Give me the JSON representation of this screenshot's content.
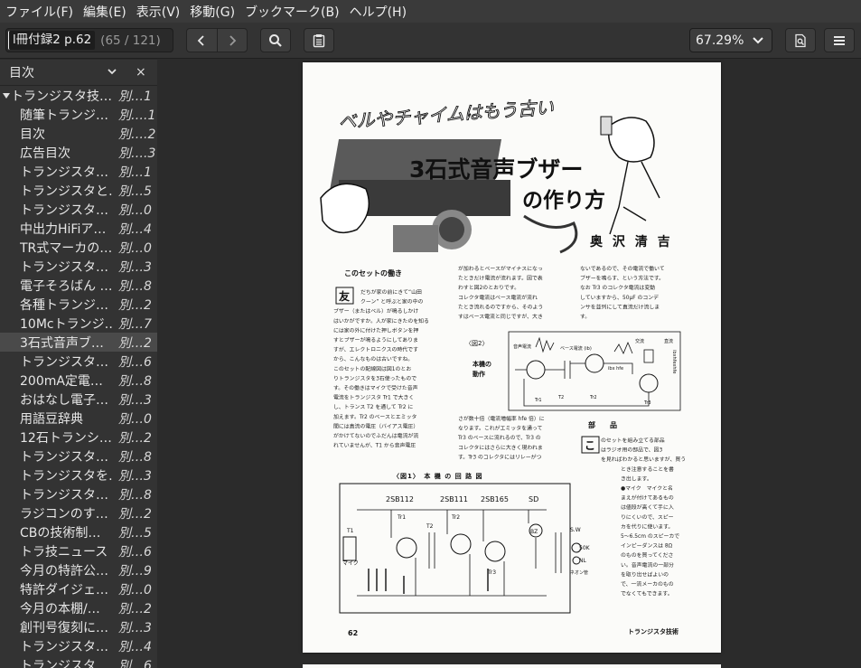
{
  "menu": [
    "ファイル(F)",
    "編集(E)",
    "表示(V)",
    "移動(G)",
    "ブックマーク(B)",
    "ヘルプ(H)"
  ],
  "toolbar": {
    "page_entry_value": "l冊付録2 p.62",
    "page_count": "(65 / 121)",
    "zoom": "67.29%",
    "icons": [
      "chevron-left-icon",
      "chevron-right-icon",
      "search-icon",
      "clipboard-icon",
      "document-search-icon",
      "hamburger-menu-icon"
    ]
  },
  "sidebar": {
    "title": "目次",
    "close_label": "×",
    "items": [
      {
        "label": "トランジスタ技…",
        "page": "別…1",
        "level": 0,
        "expanded": true
      },
      {
        "label": "随筆トランジ…",
        "page": "別….1",
        "level": 1
      },
      {
        "label": "目次",
        "page": "別….2",
        "level": 1
      },
      {
        "label": "広告目次",
        "page": "別….3",
        "level": 1
      },
      {
        "label": "トランジスタ…",
        "page": "別…1",
        "level": 1
      },
      {
        "label": "トランジスタと…",
        "page": "別…5",
        "level": 1
      },
      {
        "label": "トランジスタ…",
        "page": "別…0",
        "level": 1
      },
      {
        "label": "中出力HiFiア…",
        "page": "別…4",
        "level": 1
      },
      {
        "label": "TR式マーカの…",
        "page": "別…0",
        "level": 1
      },
      {
        "label": "トランジスタ…",
        "page": "別…3",
        "level": 1
      },
      {
        "label": "電子そろばん …",
        "page": "別…8",
        "level": 1
      },
      {
        "label": "各種トランジ…",
        "page": "別…2",
        "level": 1
      },
      {
        "label": "10Mcトランジ…",
        "page": "別…7",
        "level": 1
      },
      {
        "label": "3石式音声ブ…",
        "page": "別…2",
        "level": 1,
        "selected": true
      },
      {
        "label": "トランジスタ…",
        "page": "別…6",
        "level": 1
      },
      {
        "label": "200mA定電…",
        "page": "別…8",
        "level": 1
      },
      {
        "label": "おはなし電子…",
        "page": "別…3",
        "level": 1
      },
      {
        "label": "用語豆辞典",
        "page": "別…0",
        "level": 1
      },
      {
        "label": "12石トランシ…",
        "page": "別…2",
        "level": 1
      },
      {
        "label": "トランジスタ…",
        "page": "別…8",
        "level": 1
      },
      {
        "label": "トランジスタを…",
        "page": "別…3",
        "level": 1
      },
      {
        "label": "トランジスタ…",
        "page": "別…8",
        "level": 1
      },
      {
        "label": "ラジコンのす…",
        "page": "別…2",
        "level": 1
      },
      {
        "label": "CBの技術制…",
        "page": "別…5",
        "level": 1
      },
      {
        "label": "トラ技ニュース",
        "page": "別…6",
        "level": 1
      },
      {
        "label": "今月の特許公…",
        "page": "別…9",
        "level": 1
      },
      {
        "label": "特許ダイジェ…",
        "page": "別…0",
        "level": 1
      },
      {
        "label": "今月の本棚/…",
        "page": "別…2",
        "level": 1
      },
      {
        "label": "創刊号復刻に…",
        "page": "別…3",
        "level": 1
      },
      {
        "label": "トランジスタ…",
        "page": "別…4",
        "level": 1
      },
      {
        "label": "トランジスタ…",
        "page": "別…6",
        "level": 1
      }
    ]
  },
  "document": {
    "headline_top": "ベルやチャイムはもう古い",
    "headline_main": "3石式音声ブザー",
    "headline_sub": "の作り方",
    "author": "奥 沢 清 吉",
    "section_title": "このセットの働き",
    "dropcap_1": "友",
    "col1_lines": [
      "だちが家の前にきて“山田",
      "クーン” と呼ぶと家の中の",
      "ブザー（またはベル）が鳴るしかけ",
      "はいかがですか。人が家にきたのを知る",
      "には家の外に付けた押しボタンを押",
      "すとブザーが鳴るようにしてありま",
      "すが、エレクトロニクスの時代です",
      "から、こんなものは古いですね。",
      "このセットの配線図は図1のとお",
      "りトランジスタを3石使ったもので",
      "す。その働きはマイクで受けた音声",
      "電流をトランジスタ Tr1 で大きく",
      "し、トランス T2 を通して Tr2 に",
      "加えます。Tr2 のベースとエミッタ",
      "間には直流の電圧（バイアス電圧）",
      "がかけてないのでふだんは電流が流",
      "れていませんが、T1 から音声電圧"
    ],
    "col2_lines": [
      "が加わるとベースがマイナスになっ",
      "たときだけ電流が流れます。図で表",
      "わすと図2のとおりです。",
      "コレクタ電流はベース電流が流れ",
      "たとき流れるのですから、そのよう",
      "すはベース電流と同じですが、大き"
    ],
    "col2_lower": [
      "さが数十倍（電流増幅率 hfe 倍）に",
      "なります。これがエミッタを通って",
      "Tr3 のベースに流れるので、Tr3 の",
      "コレクタにはさらに大きく現われま",
      "す。Tr3 のコレクタにはリレーがつ"
    ],
    "col3_lines": [
      "ないであるので、その電流で働いて",
      "ブザーを鳴らす、という方法です。",
      "なお Tr3 のコレクタ電流は変動",
      "していますから、50μF のコンデ",
      "ンサを並列にして直流だけ流しま",
      "す。"
    ],
    "fig2_label": "〈図2〉",
    "fig2_caption": [
      "本機の",
      "動作"
    ],
    "fig2_texts": {
      "voice": "音声電流",
      "base": "ベース電流 (ib)",
      "ibxhfe": "ibx hfe",
      "ac": "交流",
      "dc": "直流",
      "tr1": "Tr1",
      "t2": "T2",
      "tr2": "Tr2",
      "tr3": "Tr3",
      "ibxhfexhfe": "ibxhfexhfe"
    },
    "parts_title": "部　　品",
    "dropcap_2": "こ",
    "parts_lines": [
      "のセットを組み立てる部品",
      "はラジオ用の部品で、図3",
      "を見ればわかると思いますが、買う",
      "とき注意することを書",
      "き出します。",
      "●マイク　マイクと名",
      "まえが付けてあるもの",
      "は値段が高くて手に入",
      "りにくいので、スピー",
      "カを代りに使います。",
      "5〜6.5cm のスピーカで",
      "インピーダンスは 8Ω",
      "のものを買ってくださ",
      "い。音声電流の一部分",
      "を取り出せばよいの",
      "で、一流メーカのもの",
      "でなくてもできます。"
    ],
    "fig1_title": "〈図1〉　本 機 の 回 路 図",
    "fig1_texts": {
      "q1": "2SB112",
      "q2": "2SB111",
      "q3": "2SB165",
      "sd": "SD",
      "tr1": "Tr1",
      "tr2": "Tr2",
      "tr3": "Tr3",
      "t1": "T1",
      "t2": "T2",
      "mic": "マイク",
      "bz": "BZ",
      "sw": "S.W",
      "r50k": "50K",
      "nl": "NL",
      "neon": "ネオン管"
    },
    "footer_page": "62",
    "footer_title": "トランジスタ技術"
  }
}
